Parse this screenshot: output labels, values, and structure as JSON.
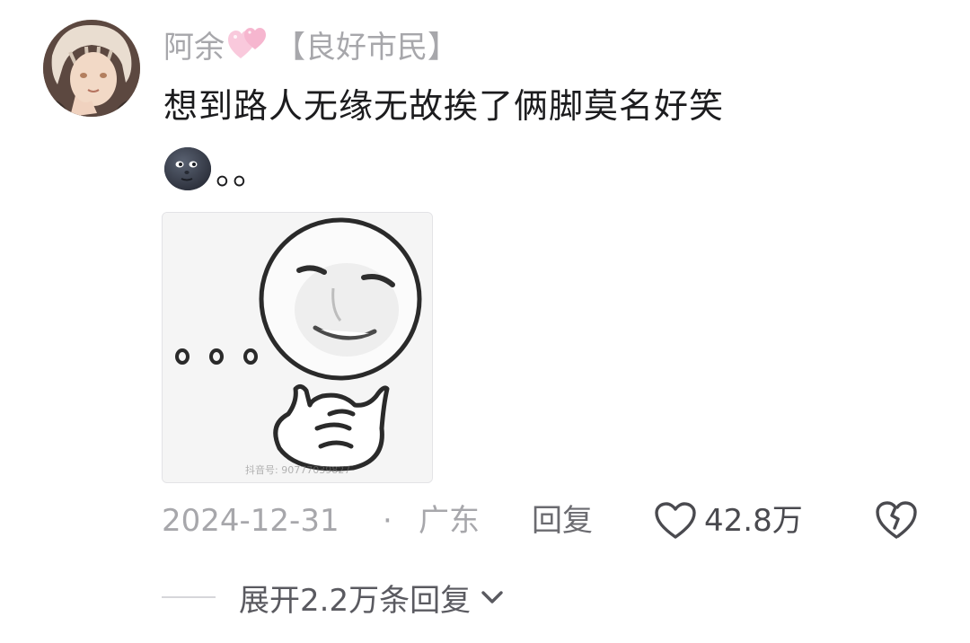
{
  "comment": {
    "username": "阿余",
    "user_badge_icon": "double-pink-heart-icon",
    "tag": "【良好市民】",
    "text_line1": "想到路人无缘无故挨了俩脚莫名好笑",
    "emoji_icon": "new-moon-face-icon",
    "text_line2_suffix": "。。",
    "image": {
      "description_icon": "meme-face-thinking-image",
      "watermark": "抖音号: 90777039827"
    },
    "date": "2024-12-31",
    "separator": "·",
    "location": "广东",
    "reply_label": "回复",
    "like_count": "42.8万",
    "expand_replies_label": "展开2.2万条回复"
  },
  "colors": {
    "meta_gray": "#a7a7ab",
    "text_dark": "#1c1c1e",
    "badge_pink": "#f6b6cf"
  }
}
